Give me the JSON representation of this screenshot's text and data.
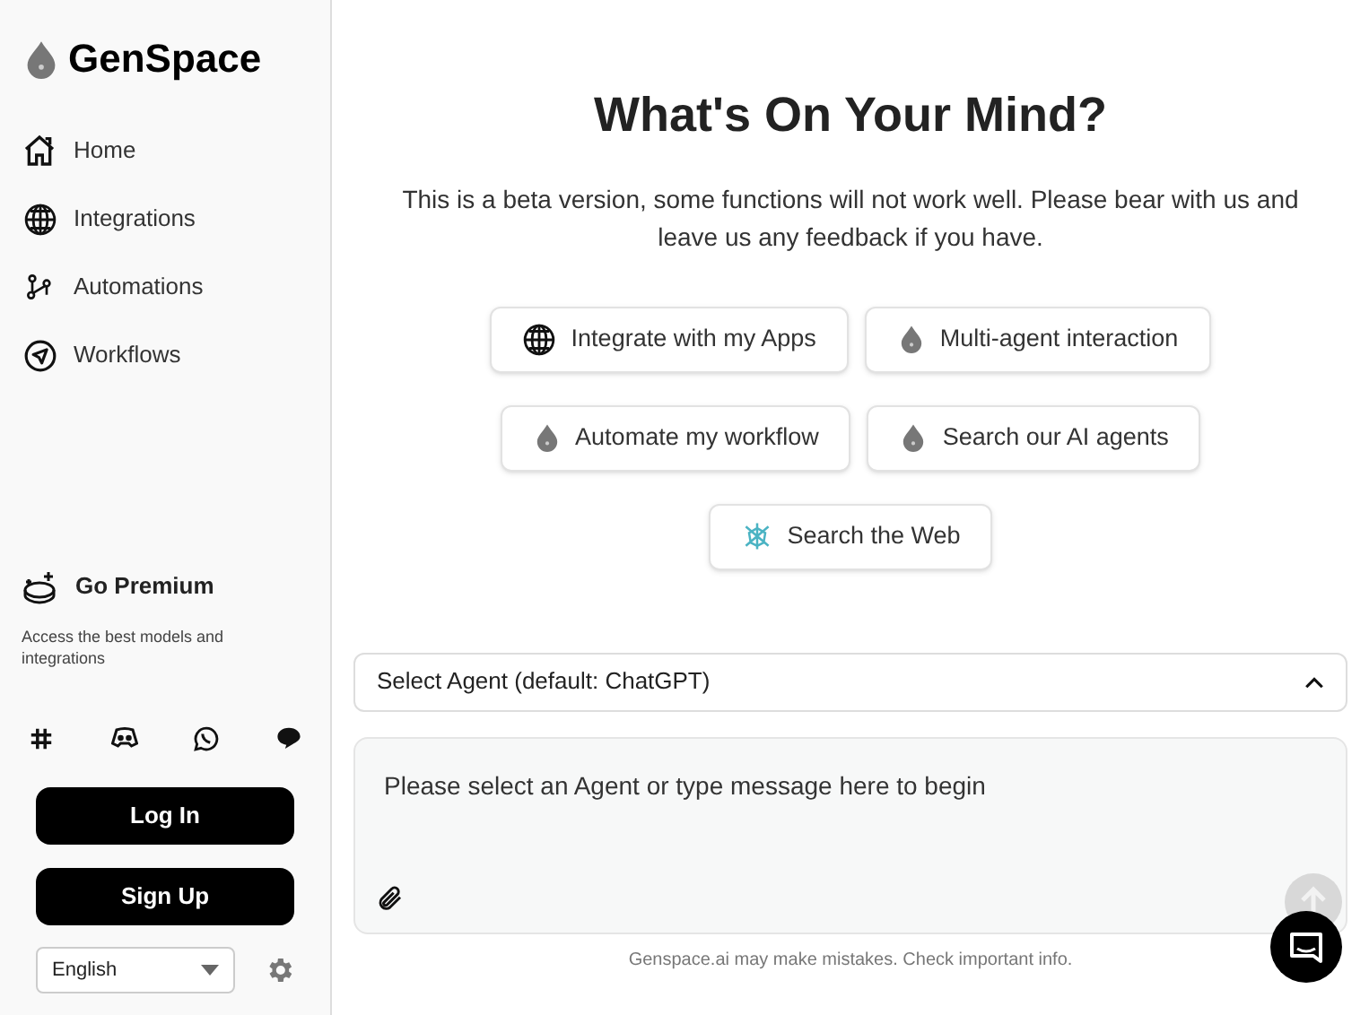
{
  "sidebar": {
    "brand": "GenSpace",
    "nav": [
      {
        "label": "Home"
      },
      {
        "label": "Integrations"
      },
      {
        "label": "Automations"
      },
      {
        "label": "Workflows"
      }
    ],
    "premium": {
      "title": "Go Premium",
      "description": "Access the best models and integrations"
    },
    "buttons": [
      "Log In",
      "Sign Up"
    ],
    "language": "English"
  },
  "main": {
    "title": "What's On Your Mind?",
    "description": "This is a beta version, some functions will not work well. Please bear with us and leave us any feedback if you have.",
    "actions": [
      [
        "Integrate with my Apps",
        "Multi-agent interaction"
      ],
      [
        "Automate my workflow",
        "Search our AI agents"
      ],
      [
        "Search the Web"
      ]
    ],
    "agent_select": {
      "label": "Select Agent (default: ChatGPT)",
      "expanded": true
    },
    "message": {
      "placeholder": "Please select an Agent or type message here to begin"
    },
    "disclaimer": "Genspace.ai may make mistakes. Check important info."
  }
}
